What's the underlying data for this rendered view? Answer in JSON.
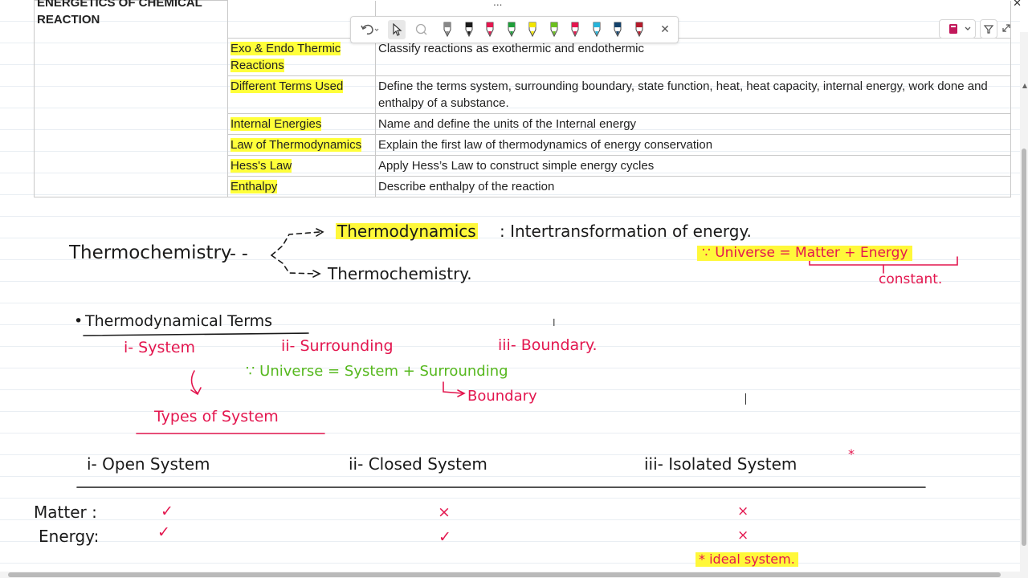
{
  "table": {
    "section_label": "ENERGETICS OF CHEMICAL REACTION",
    "rows": [
      {
        "topic": "Exo & Endo Thermic Reactions",
        "objective": "Classify reactions as exothermic and endothermic"
      },
      {
        "topic": "Different Terms Used",
        "objective": "Define the terms system, surrounding boundary, state function, heat, heat capacity, internal energy, work done and enthalpy of a substance."
      },
      {
        "topic": "Internal Energies",
        "objective": "Name and define the units of the Internal energy"
      },
      {
        "topic": "Law of Thermodynamics",
        "objective": "Explain the first law of thermodynamics of energy conservation"
      },
      {
        "topic": "Hess's Law",
        "objective": "Apply Hess’s Law to construct simple energy cycles"
      },
      {
        "topic": "Enthalpy",
        "objective": "Describe enthalpy of the reaction"
      }
    ]
  },
  "toolbar": {
    "undo_icon": "undo-icon",
    "select_icon": "pointer-icon",
    "lasso_icon": "lasso-icon",
    "pens": [
      {
        "name": "eraser-pen",
        "color": "#888888"
      },
      {
        "name": "black-pen",
        "color": "#1a1a1a"
      },
      {
        "name": "red-pen",
        "color": "#e3174f"
      },
      {
        "name": "green-pen",
        "color": "#1f9e3a"
      },
      {
        "name": "yellow-highlighter",
        "color": "#f2e500"
      },
      {
        "name": "lime-pen",
        "color": "#6bbf1f"
      },
      {
        "name": "magenta-pen",
        "color": "#e3174f"
      },
      {
        "name": "cyan-pen",
        "color": "#27b3d9"
      },
      {
        "name": "navy-pen",
        "color": "#14426b"
      },
      {
        "name": "dark-red-pen",
        "color": "#b31b2b"
      }
    ],
    "close_glyph": "✕"
  },
  "notes": {
    "thermochemistry_root": "Thermochemistry",
    "branch_top_term": "Thermodynamics",
    "branch_top_def": ": Intertransformation of energy.",
    "branch_bottom": "Thermochemistry.",
    "universe_note": "∵ Universe = Matter + Energy",
    "constant": "constant.",
    "terms_heading": "Thermodynamical Terms",
    "term_1": "i- System",
    "term_2": "ii- Surrounding",
    "term_3": "iii- Boundary.",
    "universe_system": "∵ Universe = System + Surrounding",
    "boundary": "Boundary",
    "types_heading": "Types of System",
    "type_1": "i- Open System",
    "type_2": "ii- Closed System",
    "type_3": "iii- Isolated System",
    "star": "*",
    "matter_label": "Matter :",
    "energy_label": "Energy:",
    "tick": "✓",
    "cross": "×",
    "ideal_note": "* ideal system."
  },
  "colors": {
    "ink_red": "#e3174f",
    "ink_green": "#56b81e",
    "highlight": "#ffff3a"
  },
  "window": {
    "dots": "...",
    "close": "✕"
  }
}
